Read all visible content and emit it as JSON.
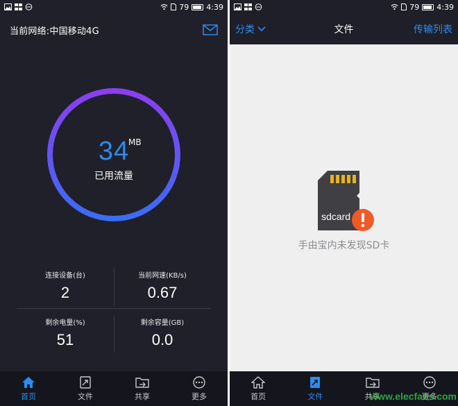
{
  "status_bar": {
    "battery": "79",
    "time": "4:39"
  },
  "left": {
    "header": {
      "title": "当前网络:中国移动4G"
    },
    "ring": {
      "value": "34",
      "unit": "MB",
      "label": "已用流量"
    },
    "stats": [
      {
        "label": "连接设备(台)",
        "value": "2"
      },
      {
        "label": "当前网速(KB/s)",
        "value": "0.67"
      },
      {
        "label": "剩余电量(%)",
        "value": "51"
      },
      {
        "label": "剩余容量(GB)",
        "value": "0.0"
      }
    ],
    "nav": [
      {
        "label": "首页",
        "icon": "home-icon",
        "active": true
      },
      {
        "label": "文件",
        "icon": "file-icon",
        "active": false
      },
      {
        "label": "共享",
        "icon": "folder-share-icon",
        "active": false
      },
      {
        "label": "更多",
        "icon": "more-icon",
        "active": false
      }
    ]
  },
  "right": {
    "header": {
      "category": "分类",
      "title": "文件",
      "transfer": "传输列表"
    },
    "sd_card": {
      "label": "sdcard"
    },
    "empty_message": "手由宝内未发现SD卡",
    "nav": [
      {
        "label": "首页",
        "icon": "home-icon",
        "active": false
      },
      {
        "label": "文件",
        "icon": "file-icon",
        "active": true
      },
      {
        "label": "共享",
        "icon": "folder-share-icon",
        "active": false
      },
      {
        "label": "更多",
        "icon": "more-icon",
        "active": false
      }
    ]
  },
  "watermark": "www.elecfans.com",
  "colors": {
    "accent": "#2d8cf0",
    "dark_bg": "#1f2029",
    "ring_start": "#8b3ef0",
    "ring_end": "#3b6cf5",
    "alert": "#f05a28"
  }
}
